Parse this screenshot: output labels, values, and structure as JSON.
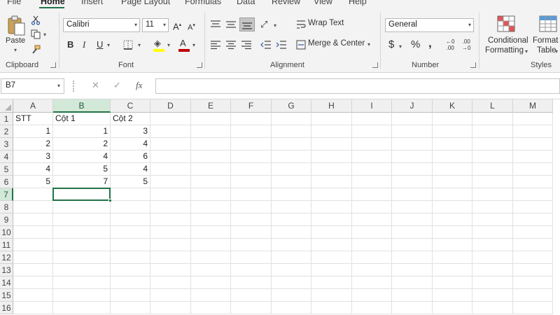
{
  "tabs": [
    "File",
    "Home",
    "Insert",
    "Page Layout",
    "Formulas",
    "Data",
    "Review",
    "View",
    "Help"
  ],
  "ribbon": {
    "clipboard": {
      "label": "Clipboard",
      "paste": "Paste"
    },
    "font": {
      "label": "Font",
      "family": "Calibri",
      "size": "11"
    },
    "alignment": {
      "label": "Alignment",
      "wrap_text": "Wrap Text",
      "merge_center": "Merge & Center"
    },
    "number": {
      "label": "Number",
      "format": "General"
    },
    "styles": {
      "label": "Styles",
      "conditional_1": "Conditional",
      "conditional_2": "Formatting",
      "format_table_1": "Format a",
      "format_table_2": "Table"
    }
  },
  "formula_bar": {
    "name_box": "B7",
    "fx": "fx",
    "value": ""
  },
  "columns": [
    "A",
    "B",
    "C",
    "D",
    "E",
    "F",
    "G",
    "H",
    "I",
    "J",
    "K",
    "L",
    "M"
  ],
  "rows": [
    "1",
    "2",
    "3",
    "4",
    "5",
    "6",
    "7",
    "8",
    "9",
    "10",
    "11",
    "12",
    "13",
    "14",
    "15",
    "16"
  ],
  "selected": {
    "column": "B",
    "row": "7"
  },
  "cells": {
    "header": [
      "STT",
      "Cột 1",
      "Cột 2"
    ],
    "data": [
      [
        "1",
        "1",
        "3"
      ],
      [
        "2",
        "2",
        "4"
      ],
      [
        "3",
        "4",
        "6"
      ],
      [
        "4",
        "5",
        "4"
      ],
      [
        "5",
        "7",
        "5"
      ]
    ]
  },
  "colors": {
    "accent": "#217346",
    "ribbon_bg": "#f3f3f3",
    "font_color": "#c00000",
    "highlight": "#ffff00"
  }
}
